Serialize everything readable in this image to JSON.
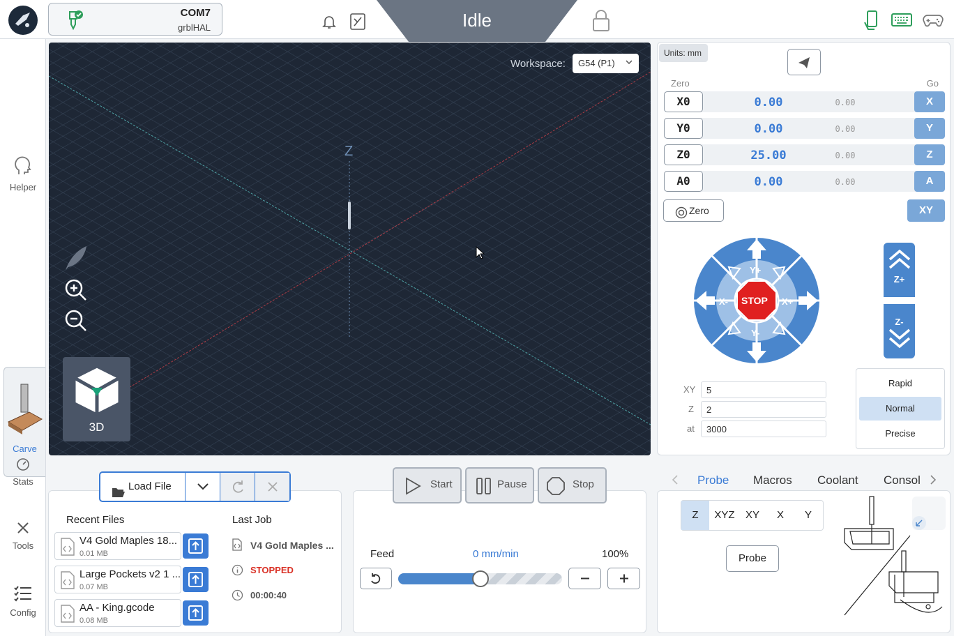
{
  "header": {
    "port": "COM7",
    "firmware": "grblHAL",
    "status": "Idle"
  },
  "sidebar": {
    "items": [
      {
        "label": "Helper"
      },
      {
        "label": "Carve"
      },
      {
        "label": "Stats"
      },
      {
        "label": "Tools"
      },
      {
        "label": "Config"
      }
    ]
  },
  "visualizer": {
    "workspace_label": "Workspace:",
    "workspace_value": "G54 (P1)",
    "axis_label": "Z",
    "view_label": "3D"
  },
  "dro": {
    "units": "Units: mm",
    "zero_header": "Zero",
    "go_header": "Go",
    "axes": [
      {
        "zero_label": "X0",
        "wpos": "0.00",
        "mpos": "0.00",
        "go_label": "X"
      },
      {
        "zero_label": "Y0",
        "wpos": "0.00",
        "mpos": "0.00",
        "go_label": "Y"
      },
      {
        "zero_label": "Z0",
        "wpos": "25.00",
        "mpos": "0.00",
        "go_label": "Z"
      },
      {
        "zero_label": "A0",
        "wpos": "0.00",
        "mpos": "0.00",
        "go_label": "A"
      }
    ],
    "zero_all_label": "Zero",
    "go_xy_label": "XY"
  },
  "jog": {
    "labels": {
      "yplus": "Y+",
      "yminus": "Y-",
      "xplus": "X+",
      "xminus": "X-",
      "stop": "STOP",
      "zplus": "Z+",
      "zminus": "Z-"
    },
    "step_rows": [
      {
        "label": "XY",
        "value": "5"
      },
      {
        "label": "Z",
        "value": "2"
      },
      {
        "label": "at",
        "value": "3000"
      }
    ],
    "speeds": [
      "Rapid",
      "Normal",
      "Precise"
    ],
    "selected_speed": "Normal"
  },
  "files": {
    "load_label": "Load File",
    "recent_title": "Recent Files",
    "recent": [
      {
        "name": "V4 Gold Maples 18...",
        "size": "0.01 MB"
      },
      {
        "name": "Large Pockets v2 1 ...",
        "size": "0.07 MB"
      },
      {
        "name": "AA - King.gcode",
        "size": "0.08 MB"
      }
    ],
    "last_job_title": "Last Job",
    "last_job_name": "V4 Gold Maples ...",
    "last_job_status": "STOPPED",
    "last_job_time": "00:00:40"
  },
  "job": {
    "start_label": "Start",
    "pause_label": "Pause",
    "stop_label": "Stop",
    "feed_label": "Feed",
    "feed_rate": "0 mm/min",
    "feed_percent": "100%",
    "feed_override_fraction": 0.5
  },
  "tools": {
    "tabs": [
      "Probe",
      "Macros",
      "Coolant",
      "Consol"
    ],
    "active_tab": "Probe",
    "probe_axes": [
      "Z",
      "XYZ",
      "XY",
      "X",
      "Y"
    ],
    "selected_probe_axis": "Z",
    "probe_button_label": "Probe"
  },
  "colors": {
    "accent": "#3a7bd5",
    "jog_blue": "#4a86cc",
    "stop_red": "#e02020",
    "status_bg": "#6b7583",
    "viewport_bg": "#1e2735",
    "stopped_red": "#d93025"
  }
}
